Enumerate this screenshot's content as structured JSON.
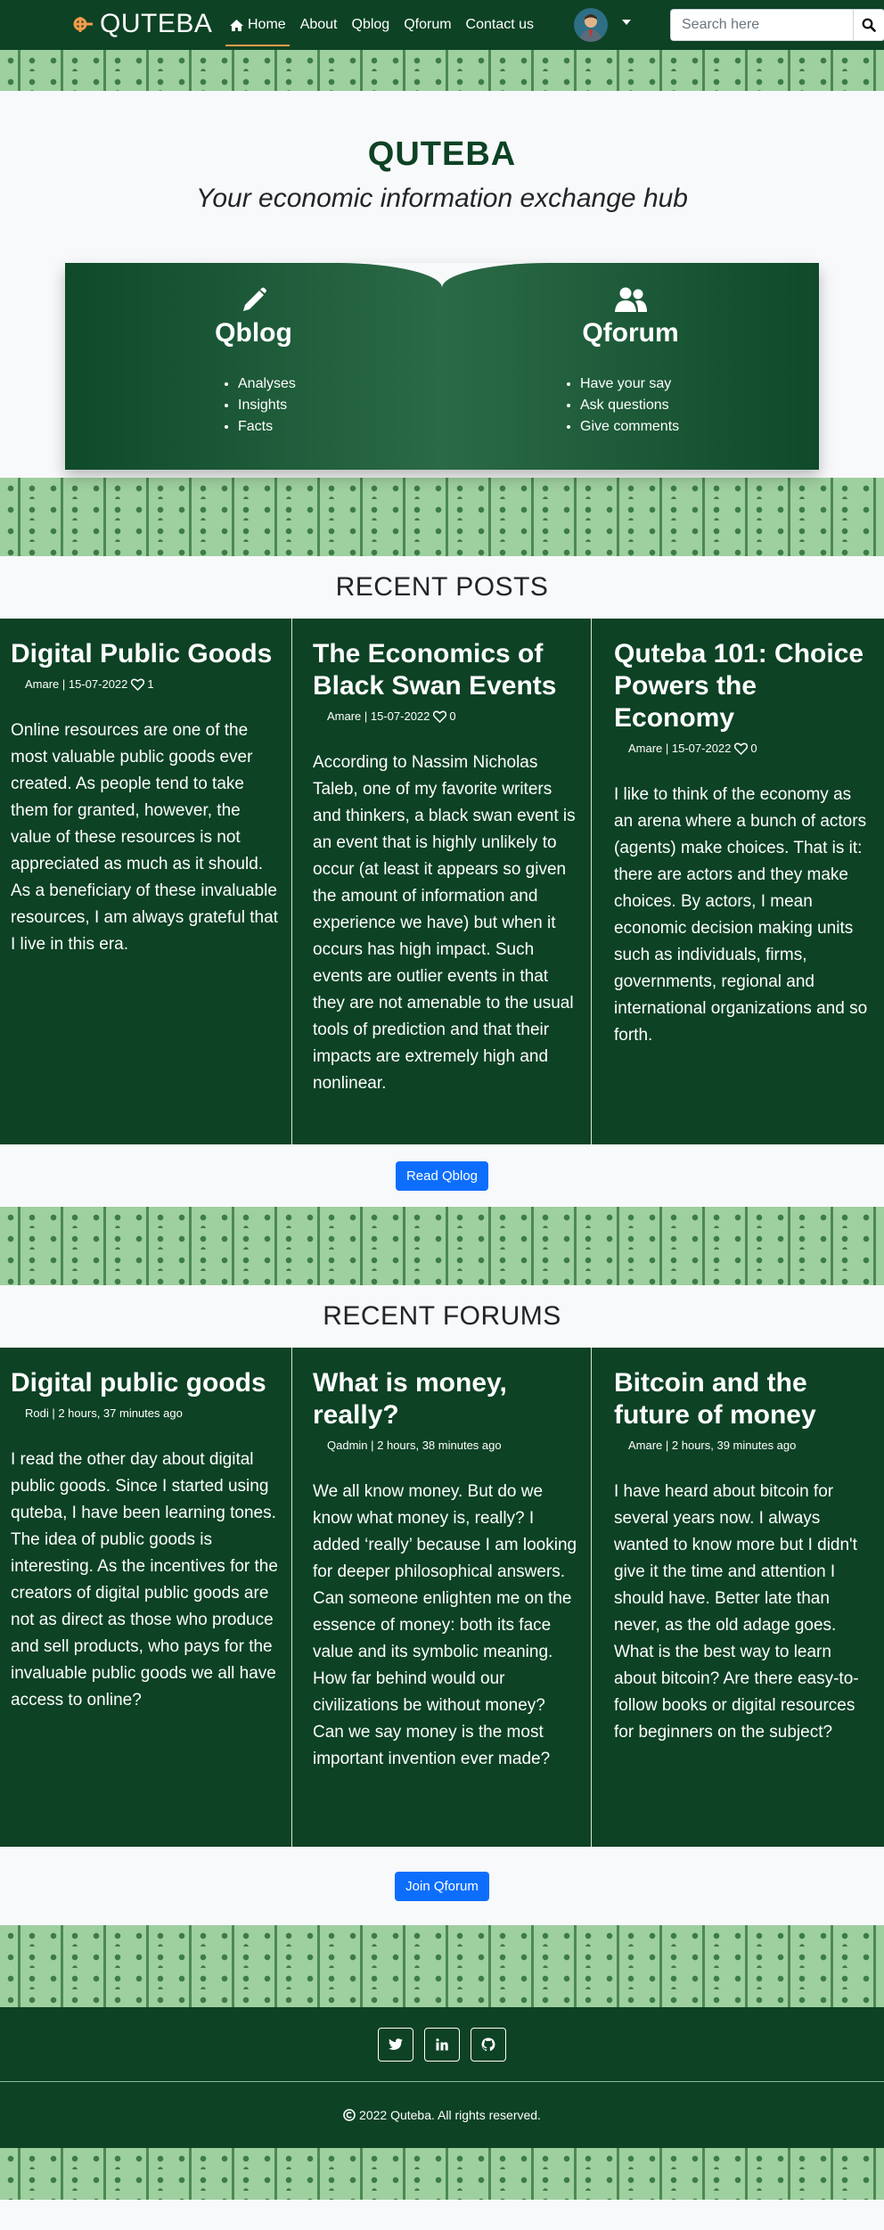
{
  "navbar": {
    "brand": "QUTEBA",
    "links": [
      {
        "label": "Home"
      },
      {
        "label": "About"
      },
      {
        "label": "Qblog"
      },
      {
        "label": "Qforum"
      },
      {
        "label": "Contact us"
      }
    ],
    "search_placeholder": "Search here"
  },
  "hero": {
    "title": "QUTEBA",
    "tagline": "Your economic information exchange hub",
    "qblog": {
      "title": "Qblog",
      "items": [
        "Analyses",
        "Insights",
        "Facts"
      ]
    },
    "qforum": {
      "title": "Qforum",
      "items": [
        "Have your say",
        "Ask questions",
        "Give comments"
      ]
    }
  },
  "posts": {
    "heading": "RECENT POSTS",
    "items": [
      {
        "title": "Digital Public Goods",
        "meta": "Amare | 15-07-2022",
        "likes": "1",
        "body": "Online resources are one of the most valuable public goods ever created. As people tend to take them for granted, however, the value of these resources is not appreciated as much as it should. As a beneficiary of these invaluable resources, I am always grateful that I live in this era."
      },
      {
        "title": "The Economics of Black Swan Events",
        "meta": "Amare | 15-07-2022",
        "likes": "0",
        "body": "According to Nassim Nicholas Taleb, one of my favorite writers and thinkers, a black swan event is an event that is highly unlikely to occur (at least it appears so given the amount of information and experience we have) but when it occurs has high impact. Such events are outlier events in that they are not amenable to the usual tools of prediction and that their impacts are extremely high and nonlinear."
      },
      {
        "title": "Quteba 101: Choice Powers the Economy",
        "meta": "Amare | 15-07-2022",
        "likes": "0",
        "body": "I like to think of the economy as an arena where a bunch of actors (agents) make choices. That is it: there are actors and they make choices. By actors, I mean economic decision making units such as individuals, firms, governments, regional and international organizations and so forth."
      }
    ],
    "cta": "Read Qblog"
  },
  "forums": {
    "heading": "RECENT FORUMS",
    "items": [
      {
        "title": "Digital public goods",
        "meta": "Rodi | 2 hours, 37 minutes ago",
        "body": "I read the other day about digital public goods. Since I started using quteba, I have been learning tones. The idea of public goods is interesting. As the incentives for the creators of digital public goods are not as direct as those who produce and sell products, who pays for the invaluable public goods we all have access to online?"
      },
      {
        "title": "What is money, really?",
        "meta": "Qadmin | 2 hours, 38 minutes ago",
        "body": "We all know money. But do we know what money is, really? I added ‘really’ because I am looking for deeper philosophical answers. Can someone enlighten me on the essence of money: both its face value and its symbolic meaning. How far behind would our civilizations be without money? Can we say money is the most important invention ever made?"
      },
      {
        "title": "Bitcoin and the future of money",
        "meta": "Amare | 2 hours, 39 minutes ago",
        "body": "I have heard about bitcoin for several years now. I always wanted to know more but I didn't give it the time and attention I should have. Better late than never, as the old adage goes. What is the best way to learn about bitcoin? Are there easy-to-follow books or digital resources for beginners on the subject?"
      }
    ],
    "cta": "Join Qforum"
  },
  "footer": {
    "social": [
      "twitter-icon",
      "linkedin-icon",
      "github-icon"
    ],
    "copyright": "2022 Quteba. All rights reserved."
  },
  "colors": {
    "primary_green": "#0d4225",
    "accent_orange": "#f39c4a",
    "button_blue": "#0d6efd",
    "pattern_green": "#9ecf9f"
  }
}
